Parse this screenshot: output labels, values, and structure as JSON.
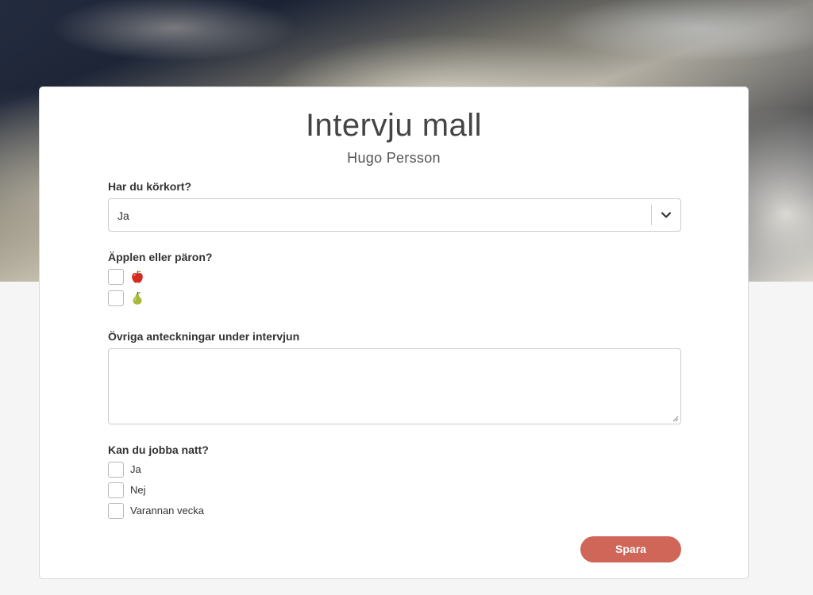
{
  "form": {
    "title": "Intervju mall",
    "candidate_name": "Hugo Persson",
    "questions": {
      "license": {
        "label": "Har du körkort?",
        "selected": "Ja"
      },
      "fruit": {
        "label": "Äpplen eller päron?",
        "options": [
          {
            "icon": "apple-icon",
            "checked": false
          },
          {
            "icon": "pear-icon",
            "checked": false
          }
        ]
      },
      "notes": {
        "label": "Övriga anteckningar under intervjun",
        "value": ""
      },
      "night": {
        "label": "Kan du jobba natt?",
        "options": [
          "Ja",
          "Nej",
          "Varannan vecka"
        ]
      }
    },
    "save_label": "Spara"
  },
  "colors": {
    "accent": "#cf6657",
    "border": "#cccccc"
  }
}
